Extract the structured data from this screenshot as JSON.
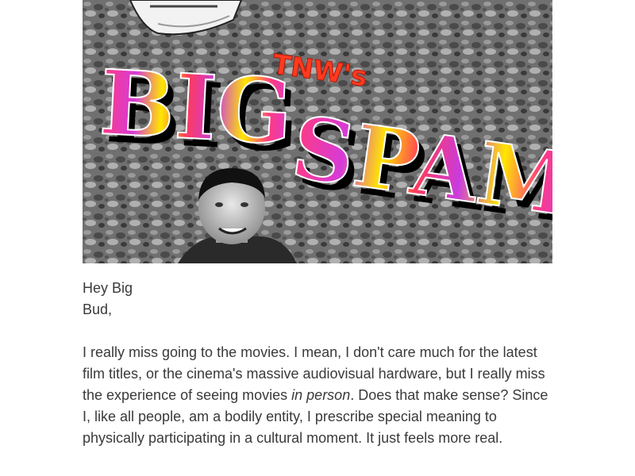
{
  "hero": {
    "small_text": "TNW's",
    "title_word_1": "BIG",
    "title_word_2": "SPAM"
  },
  "email": {
    "greeting": "Hey Big Bud,",
    "paragraph_before": "I really miss going to the movies. I mean, I don't care much for the latest film titles, or the cinema's massive audiovisual hardware, but I really miss the experience of seeing movies ",
    "paragraph_emphasis": "in person",
    "paragraph_after": ". Does that make sense? Since I, like all people, am a bodily entity, I prescribe special meaning to physically participating in a cultural moment. It just feels more real."
  },
  "colors": {
    "title_gradient_1": "#ff3b7f",
    "title_gradient_2": "#d63bd8",
    "title_gradient_3": "#ffe600",
    "accent_red": "#ff3a1f"
  }
}
